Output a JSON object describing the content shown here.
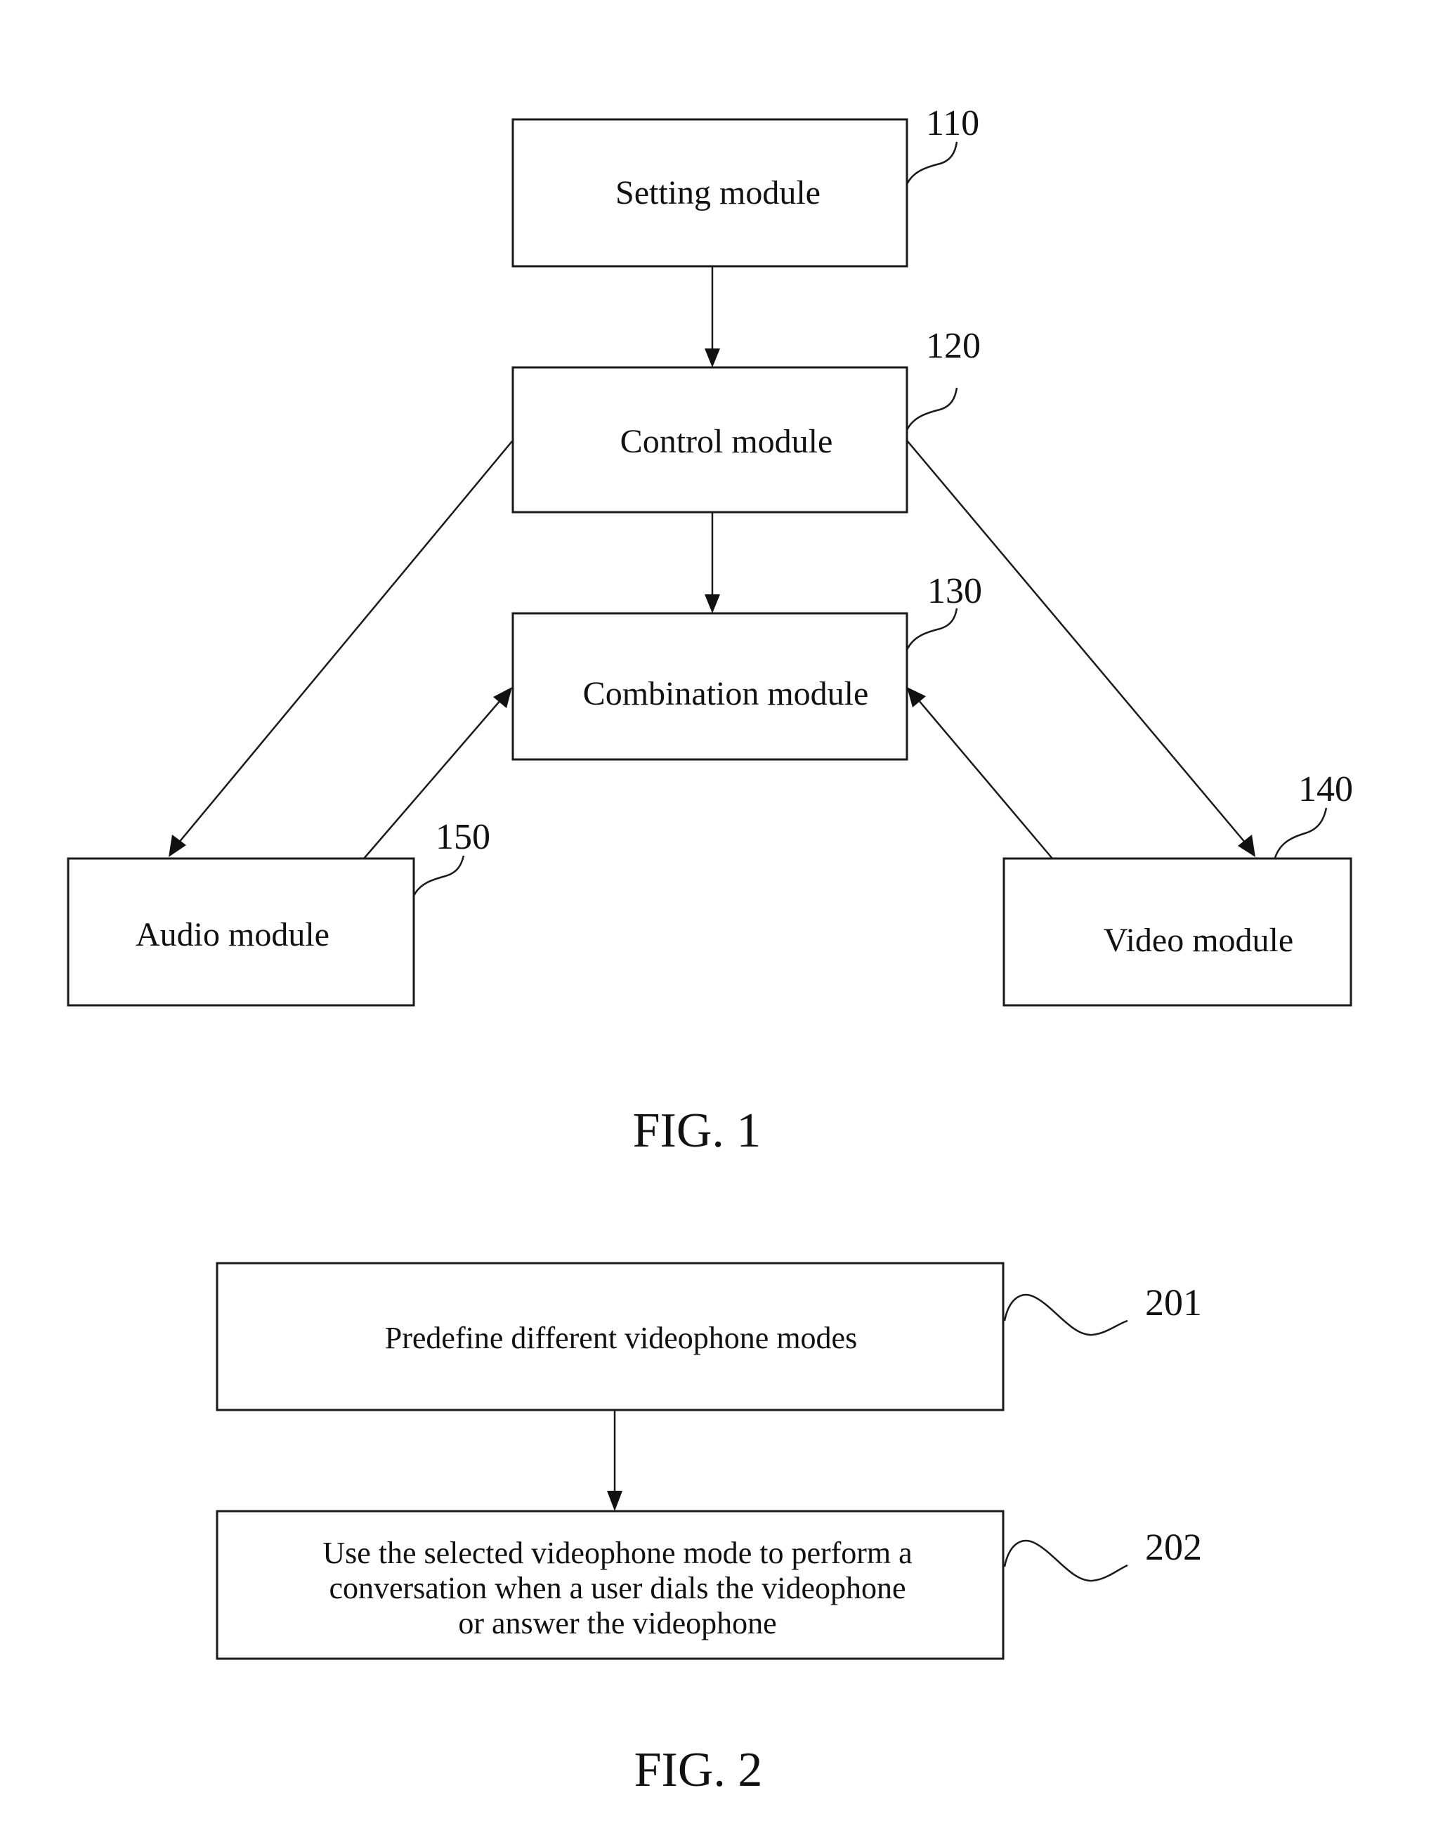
{
  "figure1": {
    "caption": "FIG. 1",
    "modules": {
      "setting": {
        "label": "Setting module",
        "ref": "110"
      },
      "control": {
        "label": "Control module",
        "ref": "120"
      },
      "combination": {
        "label": "Combination module",
        "ref": "130"
      },
      "video": {
        "label": "Video module",
        "ref": "140"
      },
      "audio": {
        "label": "Audio module",
        "ref": "150"
      }
    },
    "connections": [
      {
        "from": "setting",
        "to": "control"
      },
      {
        "from": "control",
        "to": "combination"
      },
      {
        "from": "control",
        "to": "audio"
      },
      {
        "from": "control",
        "to": "video"
      },
      {
        "from": "audio",
        "to": "combination"
      },
      {
        "from": "video",
        "to": "combination"
      }
    ]
  },
  "figure2": {
    "caption": "FIG. 2",
    "steps": [
      {
        "ref": "201",
        "lines": [
          "Predefine different videophone modes"
        ]
      },
      {
        "ref": "202",
        "lines": [
          "Use the selected videophone mode to perform a",
          "conversation when a user dials the videophone",
          "or answer the videophone"
        ]
      }
    ],
    "connections": [
      {
        "from": "201",
        "to": "202"
      }
    ]
  }
}
